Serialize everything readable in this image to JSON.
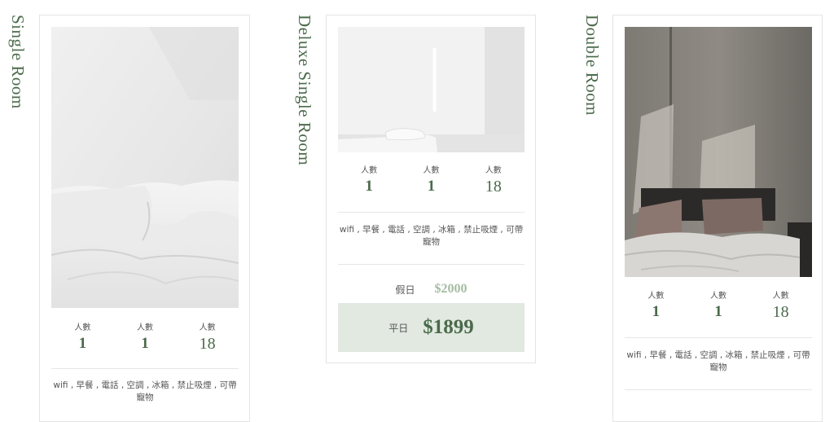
{
  "rooms": [
    {
      "title": "Single Room",
      "stats": [
        {
          "label": "人數",
          "value": "1"
        },
        {
          "label": "人數",
          "value": "1"
        },
        {
          "label": "人數",
          "value": "18"
        }
      ],
      "amenities": "wifi , 早餐 , 電話 , 空調 , 冰箱 , 禁止吸煙 , 可帶寵物"
    },
    {
      "title": "Deluxe Single Room",
      "stats": [
        {
          "label": "人數",
          "value": "1"
        },
        {
          "label": "人數",
          "value": "1"
        },
        {
          "label": "人數",
          "value": "18"
        }
      ],
      "amenities": "wifi , 早餐 , 電話 , 空調 , 冰箱 , 禁止吸煙 , 可帶寵物",
      "holiday_label": "假日",
      "holiday_price": "$2000",
      "weekday_label": "平日",
      "weekday_price": "$1899"
    },
    {
      "title": "Double Room",
      "stats": [
        {
          "label": "人數",
          "value": "1"
        },
        {
          "label": "人數",
          "value": "1"
        },
        {
          "label": "人數",
          "value": "18"
        }
      ],
      "amenities": "wifi , 早餐 , 電話 , 空調 , 冰箱 , 禁止吸煙 , 可帶寵物"
    }
  ]
}
